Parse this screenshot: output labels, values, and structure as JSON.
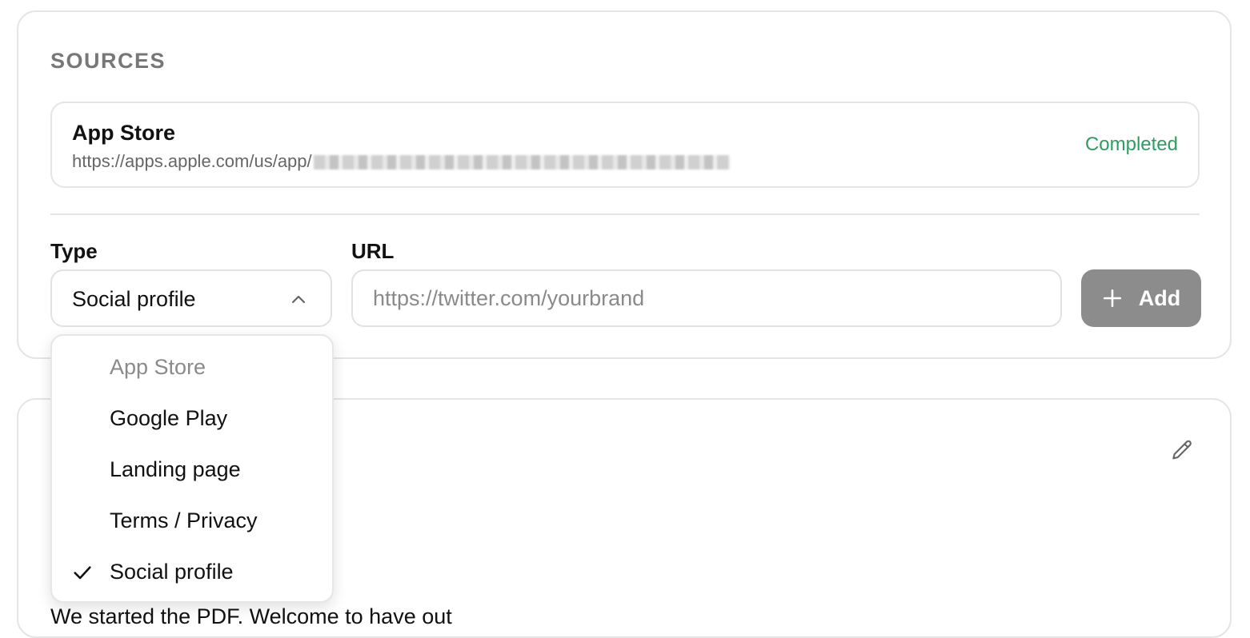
{
  "sources": {
    "title": "SOURCES",
    "items": [
      {
        "name": "App Store",
        "url_prefix": "https://apps.apple.com/us/app/",
        "status": "Completed",
        "status_color": "#2e9d62"
      }
    ]
  },
  "form": {
    "type_label": "Type",
    "url_label": "URL",
    "type_selected": "Social profile",
    "url_value": "",
    "url_placeholder": "https://twitter.com/yourbrand",
    "add_label": "Add",
    "add_button_color": "#8c8c8c"
  },
  "dropdown": {
    "options": [
      {
        "label": "App Store",
        "disabled": true
      },
      {
        "label": "Google Play",
        "disabled": false
      },
      {
        "label": "Landing page",
        "disabled": false
      },
      {
        "label": "Terms / Privacy",
        "disabled": false
      },
      {
        "label": "Social profile",
        "disabled": false,
        "selected": true
      }
    ]
  },
  "second_card": {
    "partial_text": "We started the PDF. Welcome to have out"
  },
  "icons": {
    "select_chevron": "chevron-up-icon",
    "add": "plus-icon",
    "edit": "pencil-icon",
    "selected_check": "check-icon"
  }
}
